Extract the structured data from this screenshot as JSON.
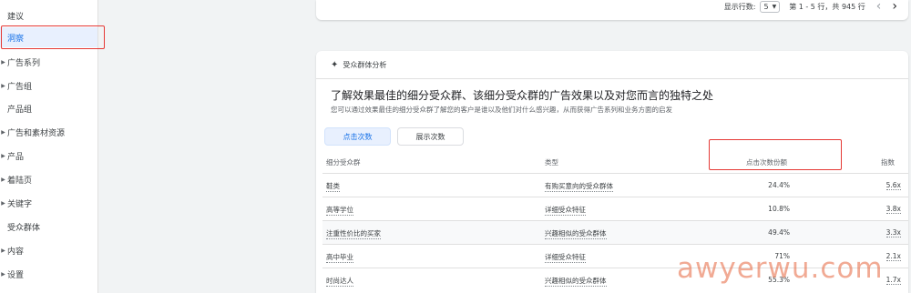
{
  "sidebar": {
    "items": [
      {
        "label": "建议",
        "caret": false
      },
      {
        "label": "洞察",
        "caret": false,
        "active": true
      },
      {
        "label": "广告系列",
        "caret": true
      },
      {
        "label": "广告组",
        "caret": true
      },
      {
        "label": "产品组",
        "caret": false
      },
      {
        "label": "广告和素材资源",
        "caret": true
      },
      {
        "label": "产品",
        "caret": true
      },
      {
        "label": "着陆页",
        "caret": true
      },
      {
        "label": "关键字",
        "caret": true
      },
      {
        "label": "受众群体",
        "caret": false
      },
      {
        "label": "内容",
        "caret": true
      },
      {
        "label": "设置",
        "caret": true
      }
    ]
  },
  "pager": {
    "rows_label": "显示行数:",
    "rows_value": "5",
    "range_text": "第 1 - 5 行，共 945 行",
    "prev_icon": "chevron-left-icon",
    "next_icon": "chevron-right-icon"
  },
  "card": {
    "header_icon": "sparkle-icon",
    "header_title": "受众群体分析",
    "headline": "了解效果最佳的细分受众群、该细分受众群的广告效果以及对您而言的独特之处",
    "subtitle": "您可以通过效果最佳的细分受众群了解您的客户是谁以及他们对什么感兴趣，从而获得广告系列和业务方面的启发",
    "tabs": [
      {
        "label": "点击次数",
        "selected": true
      },
      {
        "label": "展示次数",
        "selected": false
      }
    ],
    "columns": [
      "细分受众群",
      "类型",
      "点击次数份额",
      "指数"
    ],
    "rows": [
      {
        "segment": "鞋类",
        "type": "有购买意向的受众群体",
        "share": "24.4%",
        "index": "5.6x"
      },
      {
        "segment": "高等学位",
        "type": "详细受众特征",
        "share": "10.8%",
        "index": "3.8x"
      },
      {
        "segment": "注重性价比的买家",
        "type": "兴趣相似的受众群体",
        "share": "49.4%",
        "index": "3.3x"
      },
      {
        "segment": "高中毕业",
        "type": "详细受众特征",
        "share": "71%",
        "index": "2.1x"
      },
      {
        "segment": "时尚达人",
        "type": "兴趣相似的受众群体",
        "share": "55.3%",
        "index": "1.7x"
      }
    ]
  },
  "watermark": "awyerwu.com",
  "colors": {
    "accent": "#1a73e8",
    "highlight_box": "#e53935",
    "watermark": "#e6643c"
  }
}
